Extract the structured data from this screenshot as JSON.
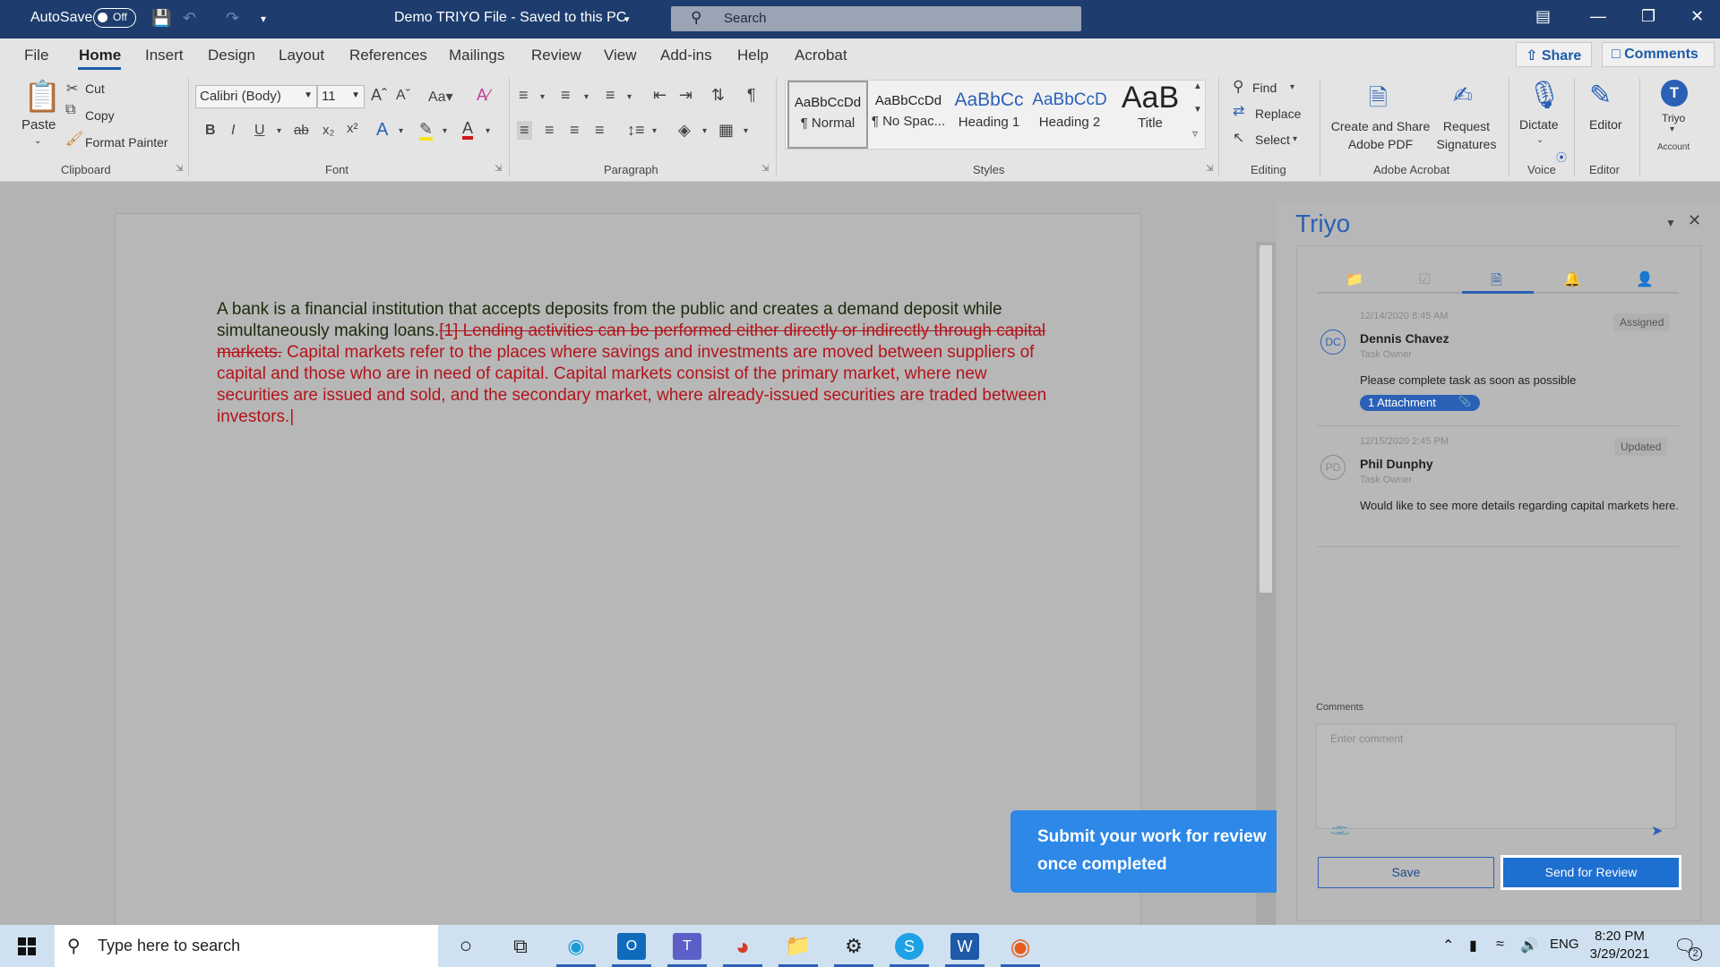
{
  "titlebar": {
    "autosave_label": "AutoSave",
    "autosave_state": "Off",
    "doc_title": "Demo TRIYO File  -  Saved to this PC",
    "search_placeholder": "Search"
  },
  "ribbon_tabs": [
    "File",
    "Home",
    "Insert",
    "Design",
    "Layout",
    "References",
    "Mailings",
    "Review",
    "View",
    "Add-ins",
    "Help",
    "Acrobat"
  ],
  "active_tab": "Home",
  "share_label": "Share",
  "comments_label": "Comments",
  "clipboard": {
    "paste": "Paste",
    "cut": "Cut",
    "copy": "Copy",
    "format_painter": "Format Painter",
    "group_label": "Clipboard"
  },
  "font": {
    "family": "Calibri (Body)",
    "size": "11",
    "group_label": "Font"
  },
  "paragraph": {
    "group_label": "Paragraph"
  },
  "styles": {
    "items": [
      {
        "preview": "AaBbCcDd",
        "name": "¶ Normal"
      },
      {
        "preview": "AaBbCcDd",
        "name": "¶ No Spac..."
      },
      {
        "preview": "AaBbCc",
        "name": "Heading 1"
      },
      {
        "preview": "AaBbCcD",
        "name": "Heading 2"
      },
      {
        "preview": "AaB",
        "name": "Title"
      }
    ],
    "group_label": "Styles"
  },
  "editing": {
    "find": "Find",
    "replace": "Replace",
    "select": "Select",
    "group_label": "Editing"
  },
  "acrobat": {
    "create_share": "Create and Share Adobe PDF",
    "request_sig": "Request Signatures",
    "group_label": "Adobe Acrobat"
  },
  "voice": {
    "dictate": "Dictate",
    "group_label": "Voice"
  },
  "editor": {
    "label": "Editor",
    "group_label": "Editor"
  },
  "account": {
    "name": "Triyo",
    "initial": "T",
    "group_label": "Account"
  },
  "document": {
    "kept_text": "A bank is a financial institution that accepts deposits from the public and creates a demand deposit while simultaneously making loans.",
    "deleted_text": "[1] Lending activities can be performed either directly or indirectly through capital markets.",
    "inserted_text": " Capital markets refer to the places where savings and investments are moved between suppliers of capital and those who are in need of capital. Capital markets consist of the primary market, where new securities are issued and sold, and the secondary market, where already-issued securities are traded between investors.",
    "colors": {
      "kept": "#1b2b0b",
      "tracked": "#b3141b"
    }
  },
  "tooltip": {
    "text": "Submit your work for review once completed"
  },
  "triyo_pane": {
    "title": "Triyo",
    "messages": [
      {
        "date": "12/14/2020  8:45 AM",
        "status": "Assigned",
        "initials": "DC",
        "name": "Dennis Chavez",
        "role": "Task Owner",
        "text": "Please complete task as soon as possible",
        "attachment": "1 Attachment"
      },
      {
        "date": "12/15/2020  2:45 PM",
        "status": "Updated",
        "initials": "PD",
        "name": "Phil Dunphy",
        "role": "Task Owner",
        "text": "Would like to see more details regarding capital markets here."
      }
    ],
    "comments_label": "Comments",
    "comment_placeholder": "Enter comment",
    "save_label": "Save",
    "send_review_label": "Send for Review"
  },
  "taskbar": {
    "search_placeholder": "Type here to search",
    "lang": "ENG",
    "time": "8:20 PM",
    "date": "3/29/2021",
    "notifications": "2"
  }
}
